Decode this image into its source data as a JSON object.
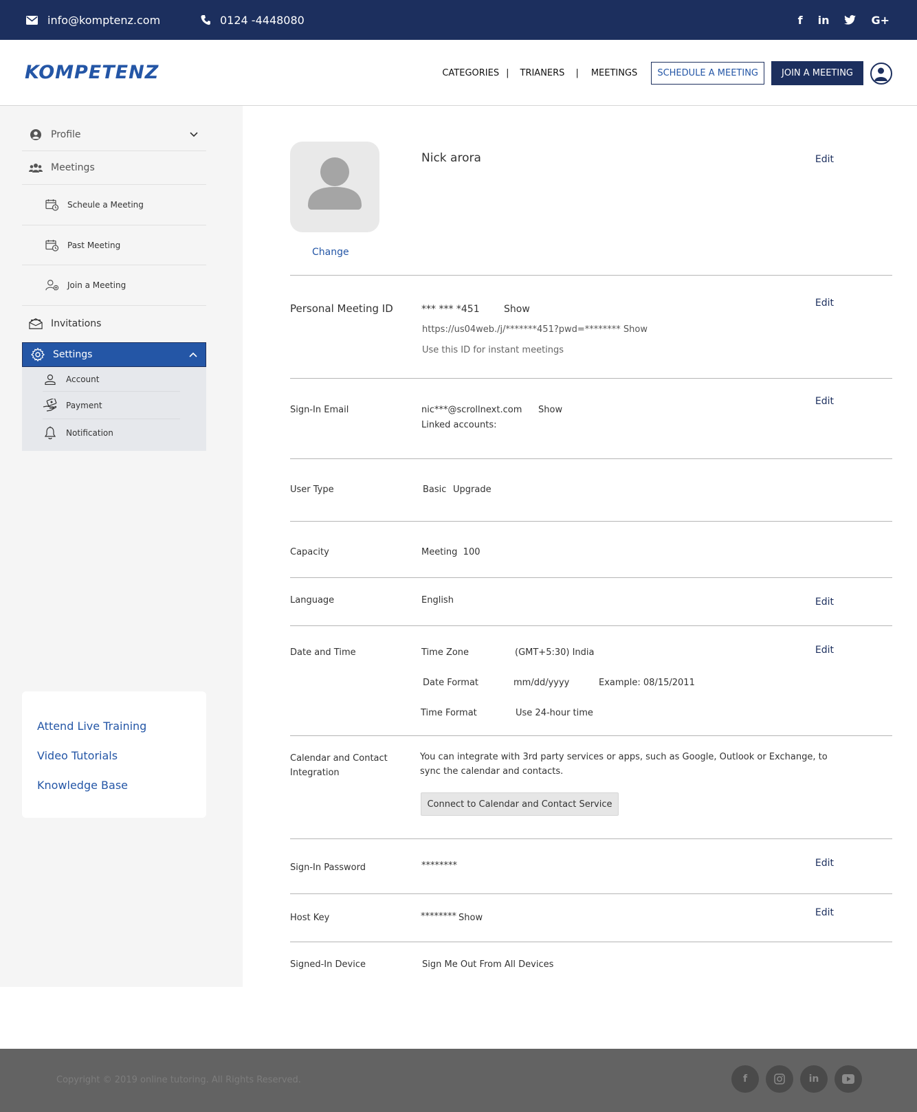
{
  "topbar": {
    "email": "info@komptenz.com",
    "phone": "0124 -4448080",
    "social": [
      "f",
      "in",
      "G+"
    ]
  },
  "header": {
    "logo": "KOMPETENZ",
    "nav": [
      "CATEGORIES",
      "TRIANERS",
      "MEETINGS"
    ],
    "separator": "|",
    "schedule_btn": "SCHEDULE A MEETING",
    "join_btn": "JOIN A MEETING"
  },
  "sidebar": {
    "profile": "Profile",
    "meetings": "Meetings",
    "schedule": "Scheule a Meeting",
    "past": "Past Meeting",
    "join": "Join a Meeting",
    "invitations": "Invitations",
    "settings": "Settings",
    "account": "Account",
    "payment": "Payment",
    "notification": "Notification",
    "help_links": [
      "Attend Live Training",
      "Video Tutorials",
      "Knowledge Base"
    ]
  },
  "profile": {
    "name": "Nick arora",
    "change": "Change",
    "edit": "Edit",
    "pmi_label": "Personal Meeting ID",
    "pmi_value": "*** *** *451",
    "show": "Show",
    "pmi_link": "https://us04web./j/*******451?pwd=******** Show",
    "pmi_note": "Use this ID for instant meetings",
    "email_label": "Sign-In Email",
    "email_value": "nic***@scrollnext.com",
    "linked": "Linked accounts:",
    "usertype_label": "User Type",
    "usertype_value": "Basic",
    "upgrade": "Upgrade",
    "capacity_label": "Capacity",
    "capacity_value": "Meeting  100",
    "language_label": "Language",
    "language_value": "English",
    "datetime_label": "Date and Time",
    "timezone_label": "Time Zone",
    "timezone_value": "(GMT+5:30) India",
    "dateformat_label": "Date Format",
    "dateformat_value": "mm/dd/yyyy",
    "dateformat_example": "Example: 08/15/2011",
    "timeformat_label": "Time Format",
    "timeformat_value": "Use 24-hour time",
    "calendar_label_1": "Calendar and Contact",
    "calendar_label_2": "Integration",
    "calendar_text_1": "You can integrate with 3rd party services or apps, such as Google, Outlook or Exchange, to",
    "calendar_text_2": "sync the calendar and contacts.",
    "connect_btn": "Connect to Calendar and Contact Service",
    "password_label": "Sign-In Password",
    "password_value": "********",
    "hostkey_label": "Host Key",
    "hostkey_value": "********",
    "device_label": "Signed-In Device",
    "device_value": "Sign Me Out From All Devices"
  },
  "footer": {
    "copyright": "Copyright © 2019 online tutoring. All Rights Reserved.",
    "social": [
      "f",
      "in"
    ]
  },
  "colors": {
    "navy": "#1c2f5e",
    "accent": "#2456a6",
    "sidebar_bg": "#f5f5f5",
    "footer_bg": "#636363"
  }
}
